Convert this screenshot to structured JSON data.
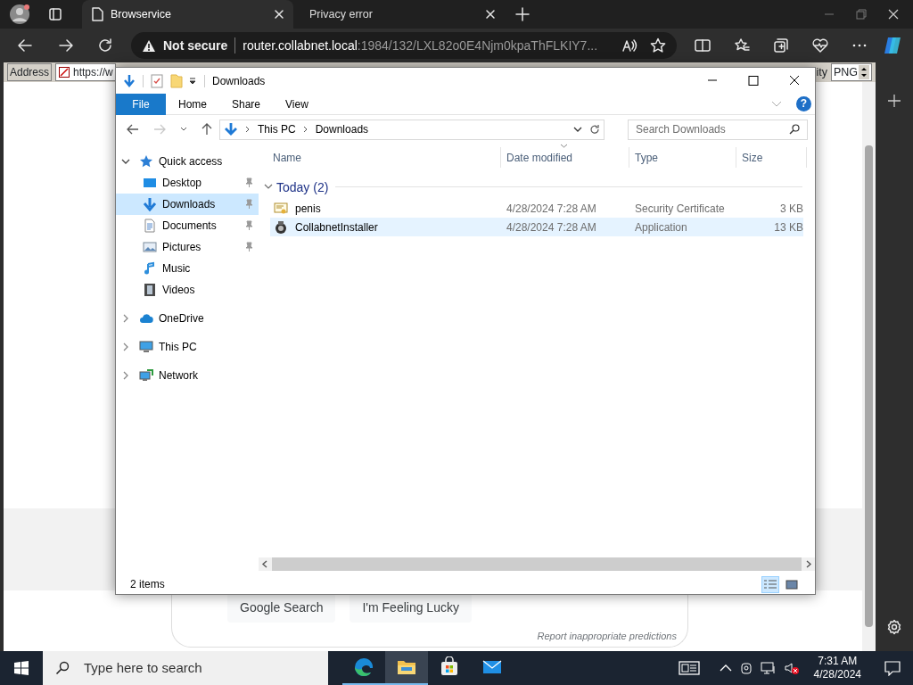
{
  "browser": {
    "tabs": [
      {
        "title": "Browservice",
        "selected": true
      },
      {
        "title": "Privacy error",
        "selected": false
      }
    ],
    "security": "Not secure",
    "url_host": "router.collabnet.local",
    "url_rest": ":1984/132/LXL82o0E4Njm0kpaThFLKIY7..."
  },
  "page": {
    "address_label": "Address",
    "address_value": "https://w",
    "right_label": "ity",
    "format": "PNG",
    "buttons": [
      "Google Search",
      "I'm Feeling Lucky"
    ],
    "report_link": "Report inappropriate predictions"
  },
  "explorer": {
    "title": "Downloads",
    "ribbon_tabs": [
      {
        "label": "File",
        "kind": "menu"
      },
      {
        "label": "Home",
        "kind": "tab"
      },
      {
        "label": "Share",
        "kind": "tab"
      },
      {
        "label": "View",
        "kind": "tab"
      }
    ],
    "help": "?",
    "breadcrumb": [
      "This PC",
      "Downloads"
    ],
    "search": {
      "placeholder": "Search Downloads"
    },
    "nav": [
      {
        "label": "Quick access",
        "kind": "star",
        "expanded": true,
        "selected": false,
        "children": [
          {
            "label": "Desktop",
            "kind": "desktop",
            "pinned": true,
            "selected": false
          },
          {
            "label": "Downloads",
            "kind": "downloads",
            "pinned": true,
            "selected": true
          },
          {
            "label": "Documents",
            "kind": "documents",
            "pinned": true,
            "selected": false
          },
          {
            "label": "Pictures",
            "kind": "pictures",
            "pinned": true,
            "selected": false
          },
          {
            "label": "Music",
            "kind": "music",
            "pinned": false,
            "selected": false
          },
          {
            "label": "Videos",
            "kind": "videos",
            "pinned": false,
            "selected": false
          }
        ]
      },
      {
        "label": "OneDrive",
        "kind": "cloud",
        "expanded": false,
        "selected": false
      },
      {
        "label": "This PC",
        "kind": "pc",
        "expanded": false,
        "selected": false
      },
      {
        "label": "Network",
        "kind": "network",
        "expanded": false,
        "selected": false
      }
    ],
    "columns": [
      "Name",
      "Date modified",
      "Type",
      "Size"
    ],
    "groups": [
      {
        "label": "Today (2)",
        "expanded": true,
        "rows": [
          {
            "kind": "certificate",
            "name": "penis",
            "date": "4/28/2024 7:28 AM",
            "type": "Security Certificate",
            "size": "3 KB",
            "selected": false
          },
          {
            "kind": "application",
            "name": "CollabnetInstaller",
            "date": "4/28/2024 7:28 AM",
            "type": "Application",
            "size": "13 KB",
            "selected": true
          }
        ]
      }
    ],
    "status": "2 items",
    "view_modes": [
      {
        "kind": "details",
        "selected": true
      },
      {
        "kind": "thumbnails",
        "selected": false
      }
    ]
  },
  "taskbar": {
    "search": {
      "placeholder": "Type here to search"
    },
    "apps": [
      {
        "kind": "edge",
        "running": true,
        "active": false
      },
      {
        "kind": "explorer",
        "running": true,
        "active": true
      },
      {
        "kind": "store",
        "running": false,
        "active": false
      },
      {
        "kind": "mail",
        "running": false,
        "active": false
      }
    ],
    "time": "7:31 AM",
    "date": "4/28/2024"
  }
}
